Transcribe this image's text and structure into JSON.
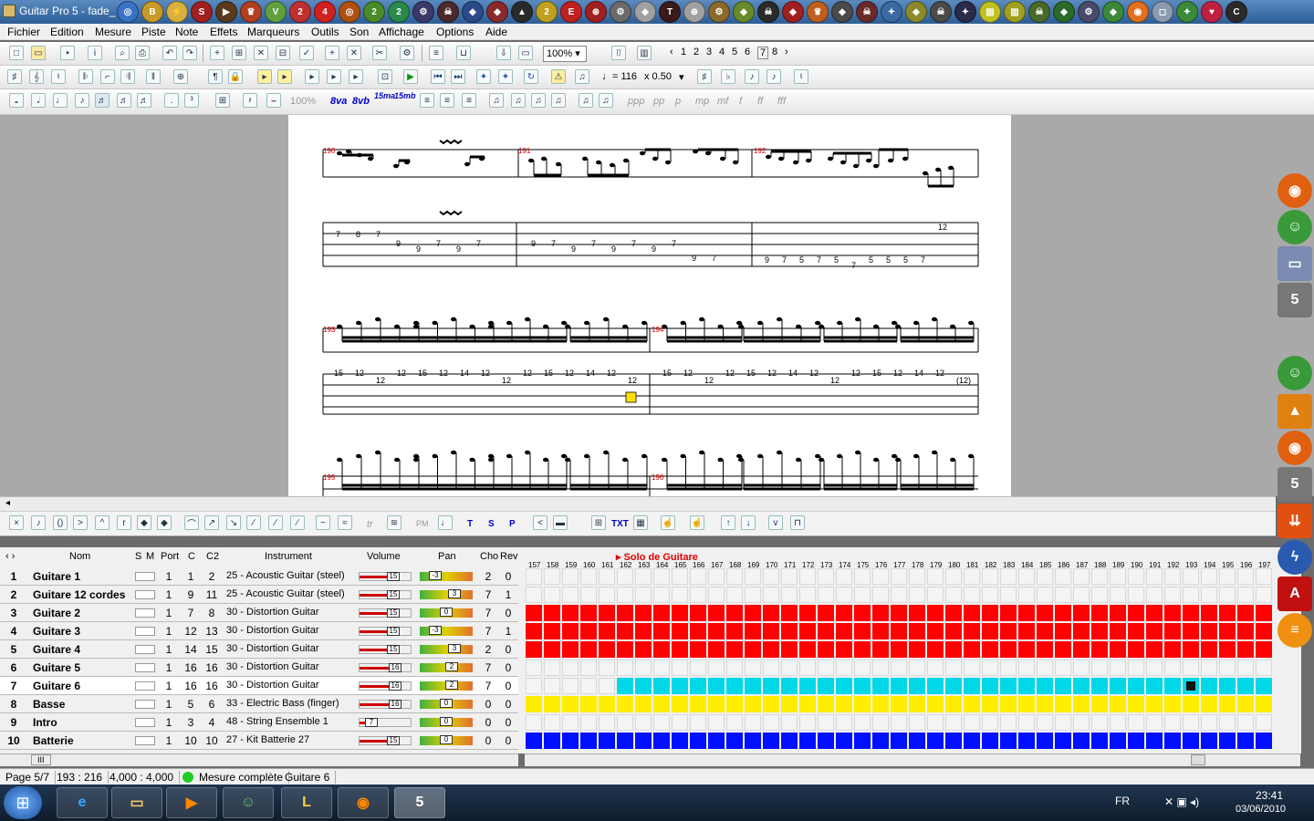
{
  "window": {
    "title": "Guitar Pro 5 - fade_"
  },
  "title_icons": [
    "◎",
    "B",
    "⚡",
    "S",
    "▶",
    "♛",
    "V",
    "2",
    "4",
    "◎",
    "2",
    "2",
    "⚙",
    "☠",
    "◆",
    "◆",
    "▲",
    "2",
    "E",
    "⊛",
    "⚙",
    "◆",
    "T",
    "⊛",
    "⚙",
    "◆",
    "☠",
    "◆",
    "♛",
    "◆",
    "☠",
    "✦",
    "◆",
    "☠",
    "✦",
    "▥",
    "▥",
    "☠",
    "◆",
    "⚙",
    "◆",
    "◉",
    "◻",
    "✦",
    "♥",
    "C"
  ],
  "title_icon_colors": [
    "#3a72c8",
    "#c89a2a",
    "#d8b040",
    "#a02020",
    "#5a3a1a",
    "#b04020",
    "#60a040",
    "#c03030",
    "#d02020",
    "#b05010",
    "#4a8a2a",
    "#2a8a4a",
    "#3a3a6a",
    "#4a2a2a",
    "#2a4a8a",
    "#8a2a2a",
    "#2a2a2a",
    "#c0a020",
    "#c02020",
    "#a02020",
    "#6a6a6a",
    "#a0a0a0",
    "#3a1a1a",
    "#a0a0a0",
    "#8a6a2a",
    "#6a8a2a",
    "#2a2a2a",
    "#a02020",
    "#c06020",
    "#4a4a4a",
    "#6a2a2a",
    "#3a6aa0",
    "#8a8a2a",
    "#4a4a4a",
    "#2a2a4a",
    "#c0c020",
    "#a0a020",
    "#4a6a2a",
    "#2a6a2a",
    "#4a4a6a",
    "#3a8a3a",
    "#e07020",
    "#8a9ab0",
    "#3a8a3a",
    "#c02040",
    "#2a2a2a"
  ],
  "menus": [
    "Fichier",
    "Edition",
    "Mesure",
    "Piste",
    "Note",
    "Effets",
    "Marqueurs",
    "Outils",
    "Son",
    "Affichage",
    "Options",
    "Aide"
  ],
  "toolbar": {
    "zoom": "100%",
    "pages": [
      "1",
      "2",
      "3",
      "4",
      "5",
      "6",
      "7",
      "8"
    ],
    "tempo": "♩= 116",
    "speed": "x 0.50",
    "velocity": "100%",
    "octave_labels": [
      "8va",
      "8vb",
      "15ma",
      "15mb"
    ],
    "dynamics": [
      "ppp",
      "pp",
      "p",
      "mp",
      "mf",
      "f",
      "ff",
      "fff"
    ],
    "fx": [
      "tr",
      "PM",
      "T",
      "S",
      "P",
      "TXT"
    ]
  },
  "score": {
    "system1": {
      "measures": [
        "190",
        "191",
        "192"
      ],
      "tabs": {
        "m190": [
          "7",
          "8",
          "7",
          "9",
          "9",
          "7",
          "9",
          "7"
        ],
        "m191": [
          "9",
          "7",
          "9",
          "7",
          "9",
          "7",
          "9",
          "7",
          "9",
          "7"
        ],
        "m192": [
          "9",
          "7",
          "5",
          "7",
          "5",
          "7",
          "5",
          "5",
          "5",
          "7",
          "12"
        ]
      }
    },
    "system2": {
      "measures": [
        "193",
        "194"
      ],
      "tabs": {
        "m193": [
          "15",
          "12",
          "12",
          "12",
          "15",
          "12",
          "14",
          "12",
          "12",
          "12",
          "15",
          "12",
          "14",
          "12",
          "12"
        ],
        "m194": [
          "15",
          "12",
          "12",
          "12",
          "15",
          "12",
          "14",
          "12",
          "12",
          "12",
          "15",
          "12",
          "14",
          "12",
          "(12)"
        ]
      }
    },
    "system3": {
      "measures": [
        "195",
        "196"
      ]
    }
  },
  "tracks": {
    "headers": {
      "name": "Nom",
      "s": "S",
      "m": "M",
      "port": "Port",
      "c": "C",
      "c2": "C2",
      "instrument": "Instrument",
      "volume": "Volume",
      "pan": "Pan",
      "cho": "Cho",
      "rev": "Rev"
    },
    "rows": [
      {
        "num": "1",
        "name": "Guitare 1",
        "port": "1",
        "c": "1",
        "c2": "2",
        "instrument": "25 - Acoustic Guitar (steel)",
        "vol": "15",
        "pan": "-3",
        "cho": "2",
        "rev": "0",
        "vol_level": 0.75,
        "pan_pos": 0.3
      },
      {
        "num": "2",
        "name": "Guitare 12 cordes",
        "port": "1",
        "c": "9",
        "c2": "11",
        "instrument": "25 - Acoustic Guitar (steel)",
        "vol": "15",
        "pan": "3",
        "cho": "7",
        "rev": "1",
        "vol_level": 0.75,
        "pan_pos": 0.65
      },
      {
        "num": "3",
        "name": "Guitare 2",
        "port": "1",
        "c": "7",
        "c2": "8",
        "instrument": "30 - Distortion Guitar",
        "vol": "15",
        "pan": "0",
        "cho": "7",
        "rev": "0",
        "vol_level": 0.75,
        "pan_pos": 0.5
      },
      {
        "num": "4",
        "name": "Guitare 3",
        "port": "1",
        "c": "12",
        "c2": "13",
        "instrument": "30 - Distortion Guitar",
        "vol": "15",
        "pan": "-3",
        "cho": "7",
        "rev": "1",
        "vol_level": 0.75,
        "pan_pos": 0.3
      },
      {
        "num": "5",
        "name": "Guitare 4",
        "port": "1",
        "c": "14",
        "c2": "15",
        "instrument": "30 - Distortion Guitar",
        "vol": "15",
        "pan": "3",
        "cho": "2",
        "rev": "0",
        "vol_level": 0.75,
        "pan_pos": 0.65
      },
      {
        "num": "6",
        "name": "Guitare 5",
        "port": "1",
        "c": "16",
        "c2": "16",
        "instrument": "30 - Distortion Guitar",
        "vol": "16",
        "pan": "2",
        "cho": "7",
        "rev": "0",
        "vol_level": 0.8,
        "pan_pos": 0.6
      },
      {
        "num": "7",
        "name": "Guitare 6",
        "port": "1",
        "c": "16",
        "c2": "16",
        "instrument": "30 - Distortion Guitar",
        "vol": "16",
        "pan": "2",
        "cho": "7",
        "rev": "0",
        "vol_level": 0.8,
        "pan_pos": 0.6
      },
      {
        "num": "8",
        "name": "Basse",
        "port": "1",
        "c": "5",
        "c2": "6",
        "instrument": "33 - Electric Bass (finger)",
        "vol": "16",
        "pan": "0",
        "cho": "0",
        "rev": "0",
        "vol_level": 0.8,
        "pan_pos": 0.5
      },
      {
        "num": "9",
        "name": "Intro",
        "port": "1",
        "c": "3",
        "c2": "4",
        "instrument": "48 - String Ensemble 1",
        "vol": "7",
        "pan": "0",
        "cho": "0",
        "rev": "0",
        "vol_level": 0.35,
        "pan_pos": 0.5
      },
      {
        "num": "10",
        "name": "Batterie",
        "port": "1",
        "c": "10",
        "c2": "10",
        "instrument": "27 - Kit Batterie 27",
        "vol": "15",
        "pan": "0",
        "cho": "0",
        "rev": "0",
        "vol_level": 0.75,
        "pan_pos": 0.5
      }
    ],
    "marker": "Solo de Guitare",
    "measure_numbers": [
      "157",
      "158",
      "159",
      "160",
      "161",
      "162",
      "163",
      "164",
      "165",
      "166",
      "167",
      "168",
      "169",
      "170",
      "171",
      "172",
      "173",
      "174",
      "175",
      "176",
      "177",
      "178",
      "179",
      "180",
      "181",
      "182",
      "183",
      "184",
      "185",
      "186",
      "187",
      "188",
      "189",
      "190",
      "191",
      "192",
      "193",
      "194",
      "195",
      "196",
      "197"
    ],
    "grid_colors": [
      "#f4f4f4",
      "#f4f4f4",
      "#ff0000",
      "#ff0000",
      "#ff0000",
      "#f4f4f4",
      "#00d8e8",
      "#ffee00",
      "#f4f4f4",
      "#0010ff"
    ],
    "row_starts": [
      0,
      0,
      0,
      0,
      0,
      0,
      5,
      0,
      0,
      0
    ]
  },
  "status": {
    "page": "Page 5/7",
    "position": "193 : 216",
    "time": "4,000 : 4,000",
    "state": "Mesure complète",
    "track": "Guitare 6"
  },
  "taskbar": {
    "lang": "FR",
    "time": "23:41",
    "date": "03/06/2010"
  }
}
